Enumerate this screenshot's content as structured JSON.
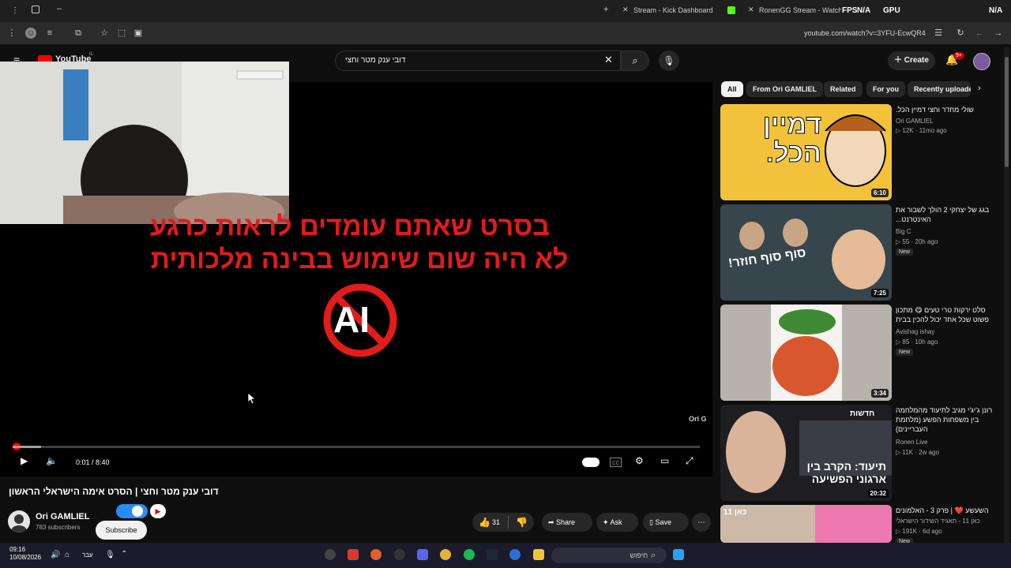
{
  "browser": {
    "tabs": [
      {
        "label": "Stream - Kick Dashboard"
      },
      {
        "label": "RonenGG Stream - Watch Live"
      }
    ],
    "hud": {
      "fps": "FPS",
      "fps_val": "N/A",
      "gpu": "GPU",
      "gpu_val": "N/A"
    },
    "url": "youtube.com/watch?v=3YFU-EcwQR4"
  },
  "youtube": {
    "logo_text": "YouTube",
    "logo_country": "IL",
    "search_value": "דובי ענק מטר וחצי",
    "create_label": "Create",
    "notif_count": "9+"
  },
  "video": {
    "overlay_line1": "בסרט שאתם עומדים לראות כרגע",
    "overlay_line2": "לא היה שום שימוש בבינה מלכותית",
    "ai_logo_text": "AI",
    "time": "0:01 / 8:40",
    "progress": 0.002,
    "watermark": "Ori G",
    "title": "דובי ענק מטר וחצי | הסרט אימה הישראלי הראשון",
    "channel_name": "Ori GAMLIEL",
    "channel_subs": "783 subscribers",
    "subscribe_label": "Subscribe",
    "like_count": "31",
    "share_label": "Share",
    "ask_label": "Ask",
    "save_label": "Save"
  },
  "sidebar": {
    "chips": [
      "All",
      "From Ori GAMLIEL",
      "Related",
      "For you",
      "Recently uploaded"
    ],
    "items": [
      {
        "title": "שולי מחדר וחצי דמיין הכל.",
        "channel": "Ori GAMLIEL",
        "meta": "12K · 11mo ago",
        "duration": "6:10",
        "thumb_text": "דמיין הכל.",
        "new": ""
      },
      {
        "title": "בגג של יצחקי 2 הולך לשבור את האינטרנט...",
        "channel": "Big C",
        "meta": "55 · 20h ago",
        "duration": "7:25",
        "thumb_text": "סוף סוף חוזר!",
        "new": "New"
      },
      {
        "title": "סלט ירקות טרי טעים 😋 מתכון פשוט שכל אחד יכול להכין בבית",
        "channel": "Avishag ishay",
        "meta": "85 · 10h ago",
        "duration": "3:34",
        "thumb_text": "",
        "new": "New"
      },
      {
        "title": "רונן ג'יג'י מגיב לתיעוד מהמלחמה בין משפחות הפשע (מלחמת העבריינים)",
        "channel": "Ronen Live",
        "meta": "11K · 2w ago",
        "duration": "20:32",
        "thumb_text": "תיעוד: הקרב בין ארגוני הפשיעה",
        "thumb_tag": "חדשות",
        "new": ""
      },
      {
        "title": "השעשע ❤️ | פרק 3 - האלמונים",
        "channel": "כאן 11 - תאגיד השידור הישראלי",
        "meta": "191K · 6d ago",
        "duration": "",
        "thumb_text": "כאן 11",
        "new": "New"
      }
    ]
  },
  "taskbar": {
    "time": "09:16",
    "date": "10/08/2026",
    "lang": "עבר",
    "search_placeholder": "חיפוש"
  },
  "colors": {
    "accent": "#ff0000",
    "overlay_red": "#e21b1b",
    "toggle_blue": "#2a8cf0"
  }
}
